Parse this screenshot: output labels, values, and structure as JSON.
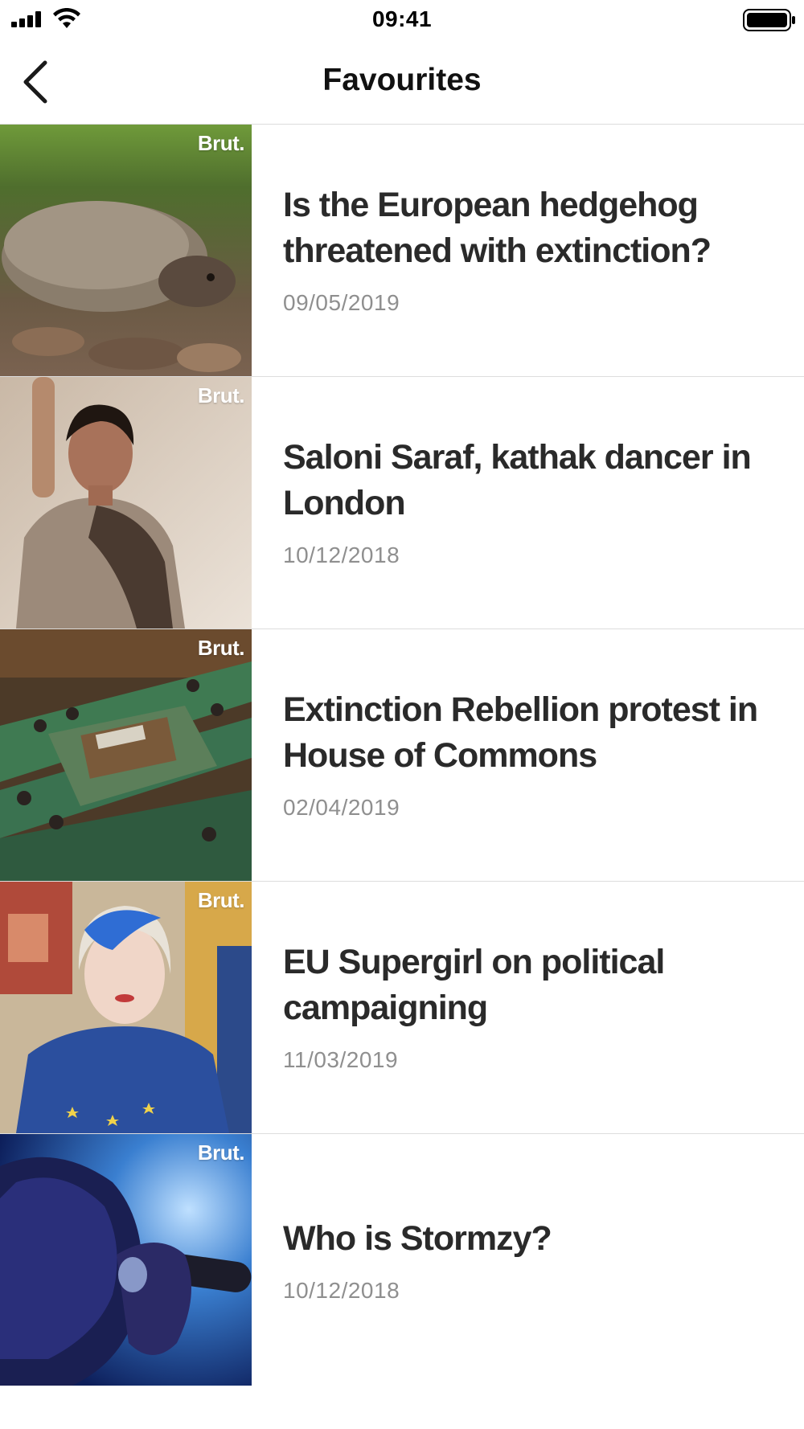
{
  "status_bar": {
    "time": "09:41",
    "icons": [
      "cellular-signal-icon",
      "wifi-icon",
      "battery-icon"
    ]
  },
  "nav": {
    "title": "Favourites",
    "back_icon": "chevron-left-icon"
  },
  "brand_label": "Brut.",
  "items": [
    {
      "title": "Is the European hedgehog threatened with extinction?",
      "date": "09/05/2019"
    },
    {
      "title": "Saloni Saraf, kathak dancer in London",
      "date": "10/12/2018"
    },
    {
      "title": "Extinction Rebellion protest in House of Commons",
      "date": "02/04/2019"
    },
    {
      "title": "EU Supergirl on political campaigning",
      "date": "11/03/2019"
    },
    {
      "title": "Who is Stormzy?",
      "date": "10/12/2018"
    }
  ],
  "colors": {
    "text_primary": "#2a2a2a",
    "text_secondary": "#8f8f8f",
    "divider": "#dddddd",
    "background": "#ffffff"
  }
}
